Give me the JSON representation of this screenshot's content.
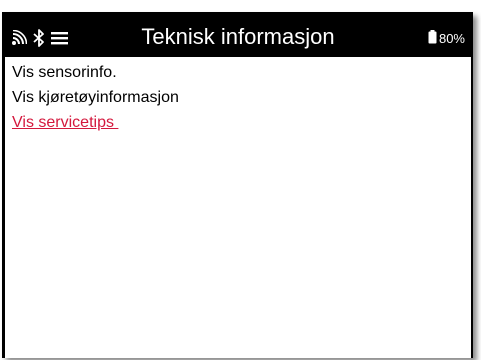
{
  "header": {
    "title": "Teknisk informasjon",
    "battery_level": "80%",
    "icons": [
      "signal-icon",
      "bluetooth-icon",
      "menu-icon",
      "battery-icon"
    ]
  },
  "menu": {
    "items": [
      {
        "label": "Vis sensorinfo."
      },
      {
        "label": "Vis kjøretøyinformasjon"
      },
      {
        "label": "Vis servicetips "
      }
    ],
    "selected_index": 2
  },
  "colors": {
    "header_bg": "#000000",
    "header_text": "#ffffff",
    "selected_text": "#d4183d"
  }
}
